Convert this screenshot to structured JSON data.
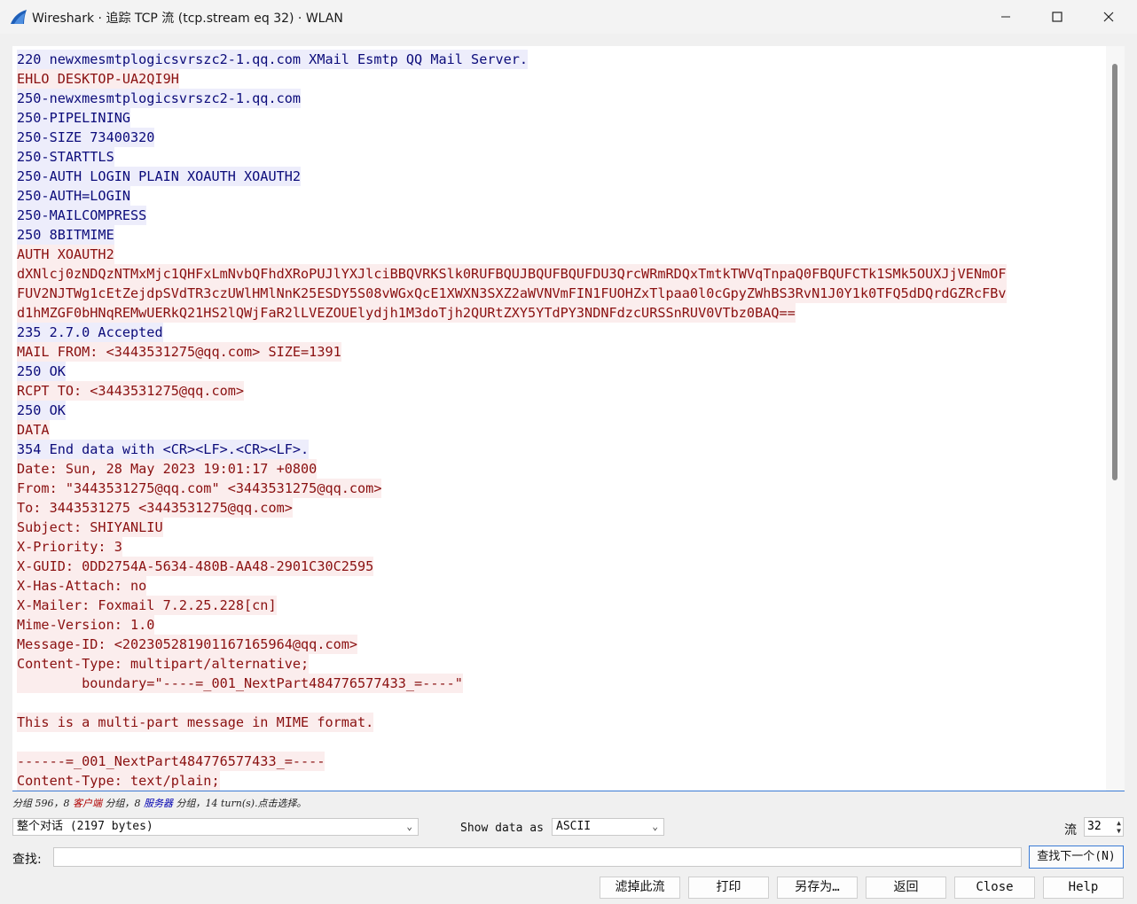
{
  "window": {
    "title": "Wireshark · 追踪 TCP 流 (tcp.stream eq 32) · WLAN",
    "app_icon": "wireshark-fin-icon",
    "controls": [
      "minimize-icon",
      "maximize-icon",
      "close-icon"
    ]
  },
  "colors": {
    "client_text": "#8a1010",
    "client_bg": "#fbeded",
    "server_text": "#0b0b7a",
    "server_bg": "#ededfb"
  },
  "stream": {
    "lines": [
      {
        "dir": "s",
        "text": "220 newxmesmtplogicsvrszc2-1.qq.com XMail Esmtp QQ Mail Server."
      },
      {
        "dir": "c",
        "text": "EHLO DESKTOP-UA2QI9H"
      },
      {
        "dir": "s",
        "text": "250-newxmesmtplogicsvrszc2-1.qq.com"
      },
      {
        "dir": "s",
        "text": "250-PIPELINING"
      },
      {
        "dir": "s",
        "text": "250-SIZE 73400320"
      },
      {
        "dir": "s",
        "text": "250-STARTTLS"
      },
      {
        "dir": "s",
        "text": "250-AUTH LOGIN PLAIN XOAUTH XOAUTH2"
      },
      {
        "dir": "s",
        "text": "250-AUTH=LOGIN"
      },
      {
        "dir": "s",
        "text": "250-MAILCOMPRESS"
      },
      {
        "dir": "s",
        "text": "250 8BITMIME"
      },
      {
        "dir": "c",
        "text": "AUTH XOAUTH2"
      },
      {
        "dir": "c",
        "text": "dXNlcj0zNDQzNTMxMjc1QHFxLmNvbQFhdXRoPUJlYXJlciBBQVRKSlk0RUFBQUJBQUFBQUFDU3QrcWRmRDQxTmtkTWVqTnpaQ0FBQUFCTk1SMk5OUXJjVENmOF"
      },
      {
        "dir": "c",
        "text": "FUV2NJTWg1cEtZejdpSVdTR3czUWlHMlNnK25ESDY5S08vWGxQcE1XWXN3SXZ2aWVNVmFIN1FUOHZxTlpaa0l0cGpyZWhBS3RvN1J0Y1k0TFQ5dDQrdGZRcFBv"
      },
      {
        "dir": "c",
        "text": "d1hMZGF0bHNqREMwUERkQ21HS2lQWjFaR2lLVEZOUElydjh1M3doTjh2QURtZXY5YTdPY3NDNFdzcURSSnRUV0VTbz0BAQ=="
      },
      {
        "dir": "s",
        "text": "235 2.7.0 Accepted"
      },
      {
        "dir": "c",
        "text": "MAIL FROM: <3443531275@qq.com> SIZE=1391"
      },
      {
        "dir": "s",
        "text": "250 OK"
      },
      {
        "dir": "c",
        "text": "RCPT TO: <3443531275@qq.com>"
      },
      {
        "dir": "s",
        "text": "250 OK"
      },
      {
        "dir": "c",
        "text": "DATA"
      },
      {
        "dir": "s",
        "text": "354 End data with <CR><LF>.<CR><LF>."
      },
      {
        "dir": "c",
        "text": "Date: Sun, 28 May 2023 19:01:17 +0800"
      },
      {
        "dir": "c",
        "text": "From: \"3443531275@qq.com\" <3443531275@qq.com>"
      },
      {
        "dir": "c",
        "text": "To: 3443531275 <3443531275@qq.com>"
      },
      {
        "dir": "c",
        "text": "Subject: SHIYANLIU"
      },
      {
        "dir": "c",
        "text": "X-Priority: 3"
      },
      {
        "dir": "c",
        "text": "X-GUID: 0DD2754A-5634-480B-AA48-2901C30C2595"
      },
      {
        "dir": "c",
        "text": "X-Has-Attach: no"
      },
      {
        "dir": "c",
        "text": "X-Mailer: Foxmail 7.2.25.228[cn]"
      },
      {
        "dir": "c",
        "text": "Mime-Version: 1.0"
      },
      {
        "dir": "c",
        "text": "Message-ID: <202305281901167165964@qq.com>"
      },
      {
        "dir": "c",
        "text": "Content-Type: multipart/alternative;"
      },
      {
        "dir": "c",
        "text": "\tboundary=\"----=_001_NextPart484776577433_=----\""
      },
      {
        "dir": "c",
        "text": ""
      },
      {
        "dir": "c",
        "text": "This is a multi-part message in MIME format."
      },
      {
        "dir": "c",
        "text": ""
      },
      {
        "dir": "c",
        "text": "------=_001_NextPart484776577433_=----"
      },
      {
        "dir": "c",
        "text": "Content-Type: text/plain;"
      }
    ]
  },
  "status": {
    "prefix": "分组 596，8 ",
    "client_word": "客户端",
    "middle": " 分组，8 ",
    "server_word": "服务器",
    "suffix": " 分组，14 turn(s).点击选择。"
  },
  "controls": {
    "conversation_value": "整个对话 (2197 bytes)",
    "show_data_label": "Show data as",
    "show_data_value": "ASCII",
    "stream_label": "流",
    "stream_value": "32",
    "find_label": "查找:",
    "find_value": "",
    "find_next_label": "查找下一个(N)"
  },
  "buttons": {
    "filter_out": "滤掉此流",
    "print": "打印",
    "save_as": "另存为…",
    "back": "返回",
    "close": "Close",
    "help": "Help"
  }
}
